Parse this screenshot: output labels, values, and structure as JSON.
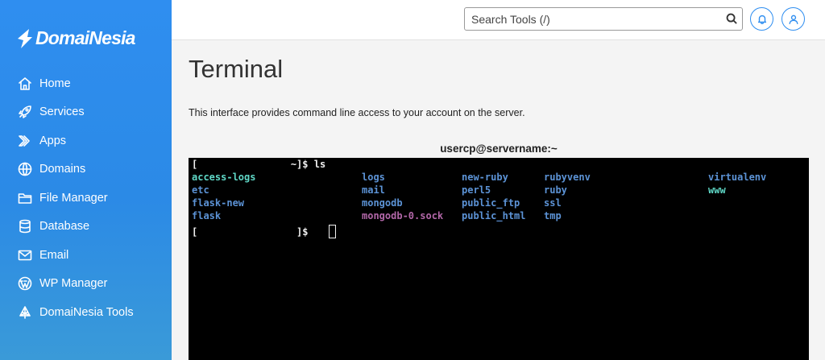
{
  "brand": {
    "name": "DomaiNesia"
  },
  "sidebar": {
    "items": [
      {
        "label": "Home",
        "icon": "home-icon"
      },
      {
        "label": "Services",
        "icon": "rocket-icon"
      },
      {
        "label": "Apps",
        "icon": "apps-icon"
      },
      {
        "label": "Domains",
        "icon": "globe-icon"
      },
      {
        "label": "File Manager",
        "icon": "folder-icon"
      },
      {
        "label": "Database",
        "icon": "database-icon"
      },
      {
        "label": "Email",
        "icon": "mail-icon"
      },
      {
        "label": "WP Manager",
        "icon": "wordpress-icon"
      },
      {
        "label": "DomaiNesia Tools",
        "icon": "tools-icon"
      }
    ]
  },
  "topbar": {
    "search_placeholder": "Search Tools (/)"
  },
  "page": {
    "title": "Terminal",
    "description": "This interface provides command line access to your account on the server."
  },
  "terminal": {
    "header": "usercp@servername:~",
    "prompt1": "[                ~]$ ls",
    "prompt2": "[                 ]$",
    "files": {
      "col1": [
        "access-logs",
        "etc",
        "flask-new",
        "flask"
      ],
      "col2": [
        "logs",
        "mail",
        "mongodb",
        "mongodb-0.sock"
      ],
      "col3": [
        "new-ruby",
        "perl5",
        "public_ftp",
        "public_html"
      ],
      "col4": [
        "rubyvenv",
        "ruby",
        "ssl",
        "tmp"
      ],
      "col5": [
        "virtualenv",
        "www"
      ]
    }
  },
  "colors": {
    "sidebar_blue": "#2f8ef0",
    "terminal_bg": "#000000",
    "dir_blue": "#5c93d6",
    "link_cyan": "#5fd7c6",
    "socket_magenta": "#b267a8"
  }
}
